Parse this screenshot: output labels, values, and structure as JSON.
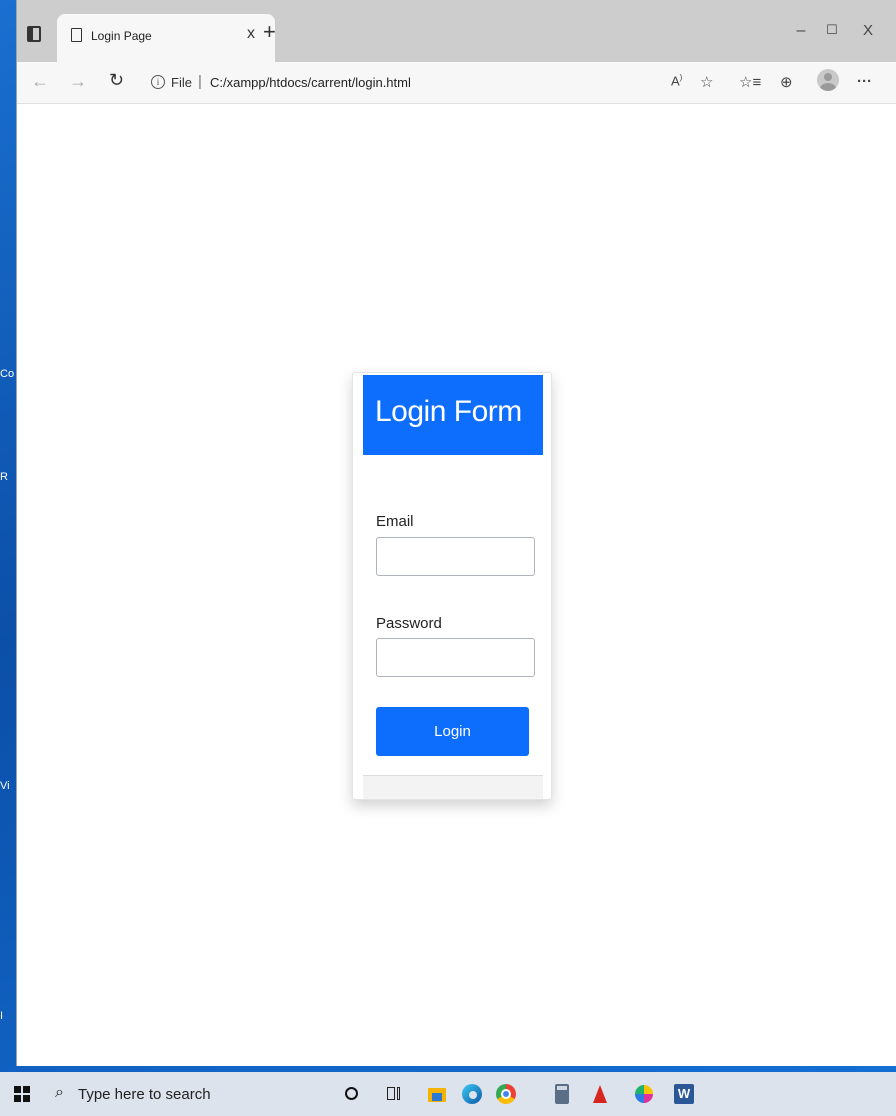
{
  "desktop": {
    "labels": [
      "Co",
      "R",
      "Vi",
      "I"
    ]
  },
  "browser": {
    "tab": {
      "title": "Login Page",
      "close": "x"
    },
    "new_tab": "+",
    "window_controls": {
      "minimize": "–",
      "maximize": "☐",
      "close": "X"
    },
    "address": {
      "scheme_label": "File",
      "separator": "|",
      "url": "C:/xampp/htdocs/carrent/login.html"
    },
    "toolbar_icons": [
      "read-aloud-icon",
      "add-favorite-icon",
      "favorites-icon",
      "collections-icon",
      "profile-icon",
      "more-icon"
    ],
    "more": "···"
  },
  "login": {
    "title": "Login Form",
    "email_label": "Email",
    "email_value": "",
    "password_label": "Password",
    "password_value": "",
    "submit_label": "Login",
    "accent_color": "#0d6efd"
  },
  "taskbar": {
    "search_placeholder": "Type here to search",
    "apps": [
      "cortana-icon",
      "task-view-icon",
      "file-explorer-icon",
      "edge-icon",
      "chrome-icon",
      "calculator-icon",
      "acrobat-icon",
      "paint-icon",
      "word-icon"
    ]
  }
}
